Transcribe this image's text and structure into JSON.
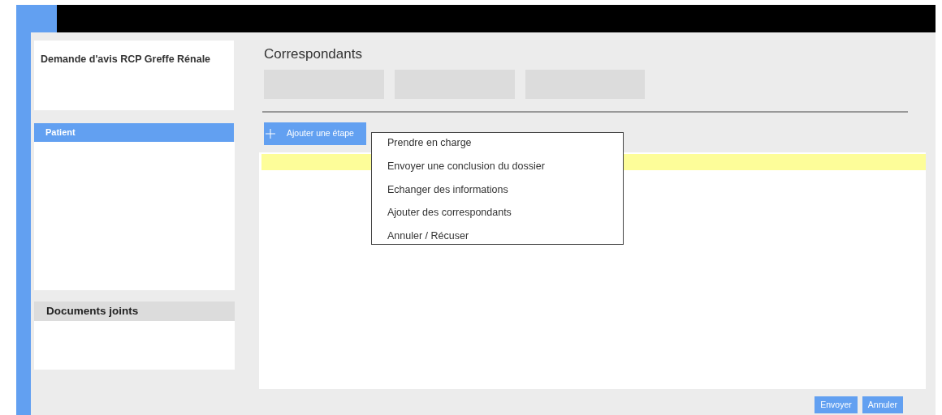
{
  "header": {
    "title": "Demande d'avis RCP Greffe Rénale"
  },
  "sections": [
    {
      "title": "Patient",
      "kind": "highlight"
    },
    {
      "title": "Documents joints",
      "kind": "plain"
    }
  ],
  "main": {
    "title": "Correspondants",
    "add_button": "Ajouter une étape"
  },
  "menu": {
    "items": [
      {
        "label": "Prendre en charge"
      },
      {
        "label": "Envoyer une conclusion du dossier"
      },
      {
        "label": "Echanger des informations"
      },
      {
        "label": "Ajouter des correspondants"
      },
      {
        "label": "Annuler / Récuser"
      }
    ]
  },
  "buttons": [
    "Envoyer",
    "Annuler"
  ]
}
